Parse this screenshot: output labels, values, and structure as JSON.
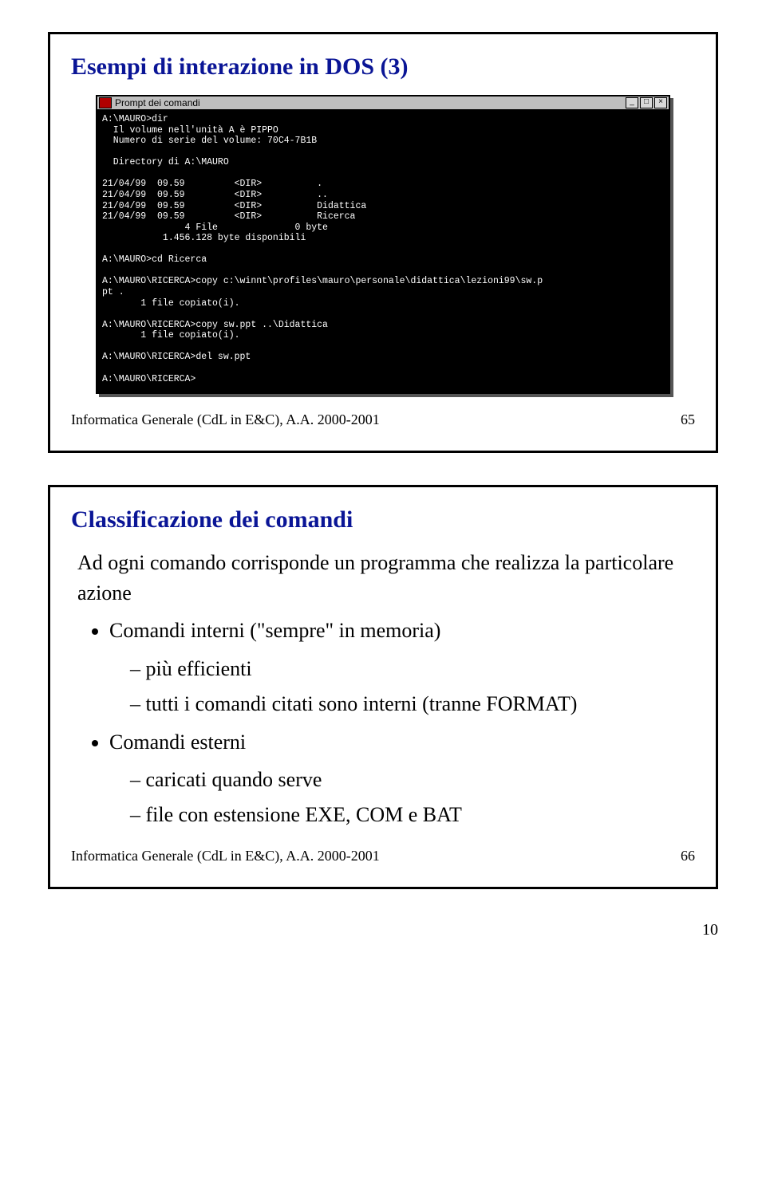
{
  "slide1": {
    "title": "Esempi di interazione in DOS (3)",
    "dos_window": {
      "titlebar": "Prompt dei comandi",
      "lines": [
        "A:\\MAURO>dir",
        "  Il volume nell'unità A è PIPPO",
        "  Numero di serie del volume: 70C4-7B1B",
        "",
        "  Directory di A:\\MAURO",
        "",
        "21/04/99  09.59         <DIR>          .",
        "21/04/99  09.59         <DIR>          ..",
        "21/04/99  09.59         <DIR>          Didattica",
        "21/04/99  09.59         <DIR>          Ricerca",
        "               4 File              0 byte",
        "           1.456.128 byte disponibili",
        "",
        "A:\\MAURO>cd Ricerca",
        "",
        "A:\\MAURO\\RICERCA>copy c:\\winnt\\profiles\\mauro\\personale\\didattica\\lezioni99\\sw.p",
        "pt .",
        "       1 file copiato(i).",
        "",
        "A:\\MAURO\\RICERCA>copy sw.ppt ..\\Didattica",
        "       1 file copiato(i).",
        "",
        "A:\\MAURO\\RICERCA>del sw.ppt",
        "",
        "A:\\MAURO\\RICERCA>"
      ]
    },
    "footer_left": "Informatica Generale (CdL in E&C), A.A. 2000-2001",
    "footer_right": "65"
  },
  "slide2": {
    "title": "Classificazione dei comandi",
    "intro": "Ad ogni comando corrisponde un programma che realizza la particolare azione",
    "bullet1": "Comandi interni (\"sempre\" in memoria)",
    "bullet1a": "più efficienti",
    "bullet1b": "tutti i comandi citati sono interni (tranne FORMAT)",
    "bullet2": "Comandi esterni",
    "bullet2a": "caricati quando serve",
    "bullet2b": "file con estensione EXE, COM e BAT",
    "footer_left": "Informatica Generale (CdL in E&C), A.A. 2000-2001",
    "footer_right": "66"
  },
  "page_number": "10"
}
